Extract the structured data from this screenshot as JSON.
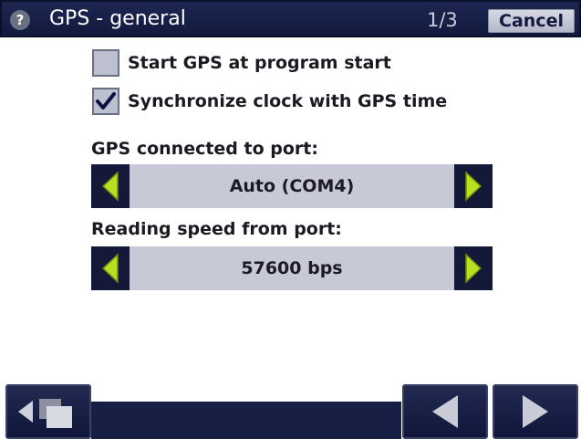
{
  "header": {
    "help_icon_glyph": "?",
    "title": "GPS - general",
    "page_indicator": "1/3",
    "cancel_label": "Cancel"
  },
  "options": [
    {
      "label": "Start GPS at program start",
      "checked": false
    },
    {
      "label": "Synchronize clock with GPS time",
      "checked": true
    }
  ],
  "port": {
    "label": "GPS connected to port:",
    "value": "Auto (COM4)"
  },
  "speed": {
    "label": "Reading speed from port:",
    "value": "57600 bps"
  },
  "icons": {
    "help": "help-icon",
    "checkmark": "checkmark-icon",
    "arrow_left": "arrow-left-icon",
    "arrow_right": "arrow-right-icon",
    "windows": "windows-icon"
  },
  "colors": {
    "titlebar": "#1c2650",
    "arrow_green": "#b8e020",
    "selector_bg": "#c7cad6",
    "checkbox_bg": "#bcc0cf"
  }
}
